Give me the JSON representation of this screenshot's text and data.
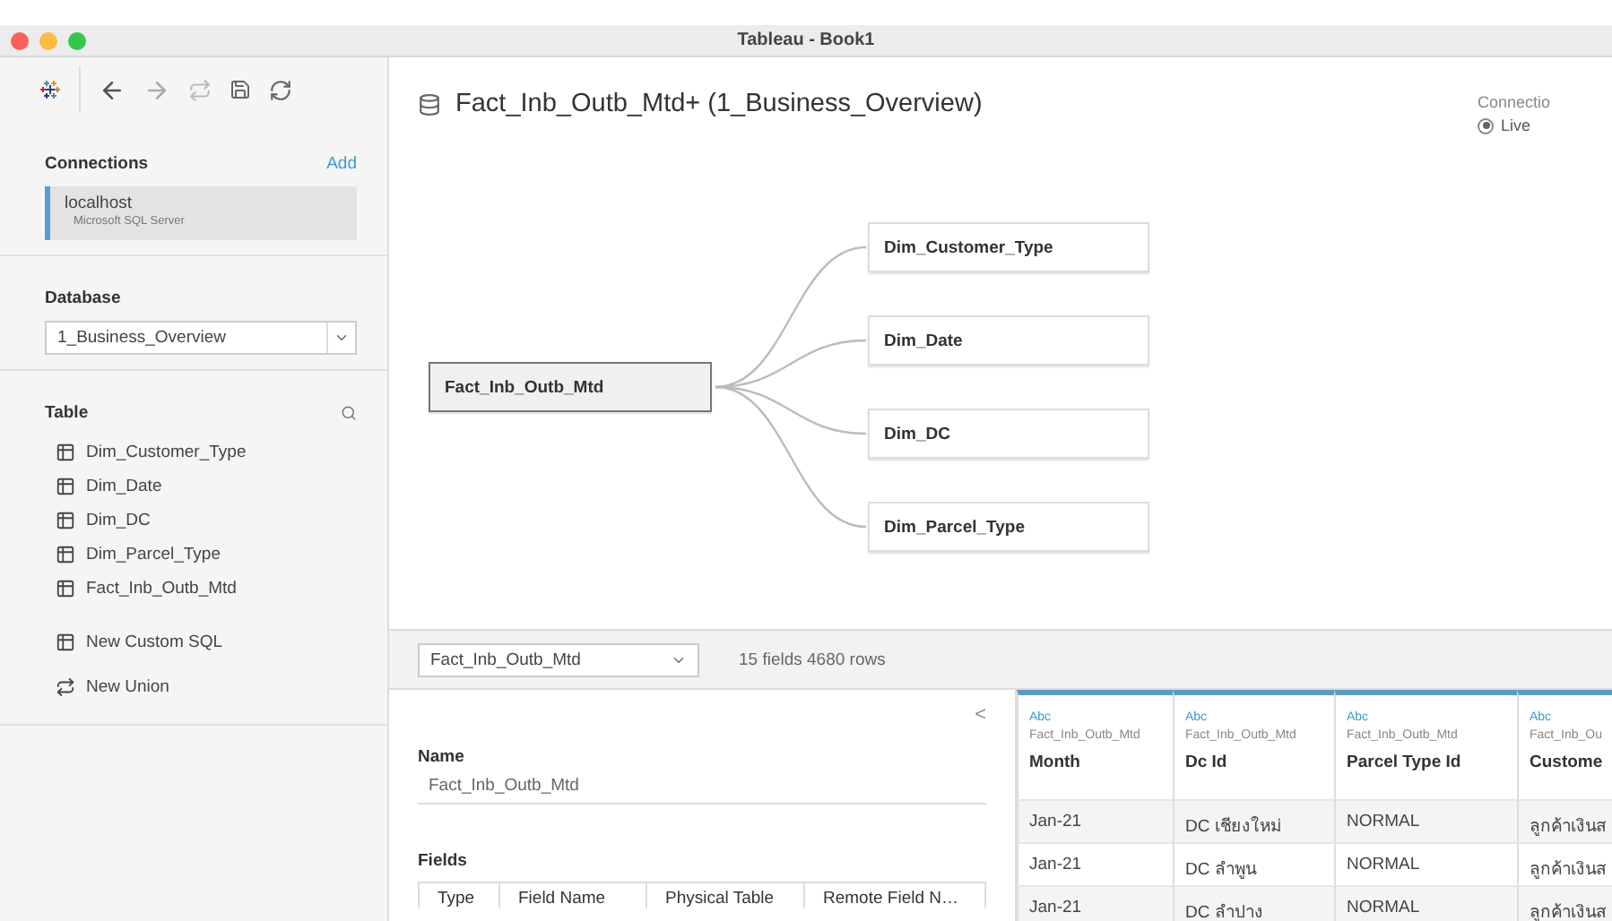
{
  "window": {
    "title": "Tableau - Book1"
  },
  "sidebar": {
    "connections_heading": "Connections",
    "add_link": "Add",
    "connections": [
      {
        "name": "localhost",
        "type": "Microsoft SQL Server",
        "selected": true
      }
    ],
    "database_heading": "Database",
    "database": "1_Business_Overview",
    "table_heading": "Table",
    "tables": [
      "Dim_Customer_Type",
      "Dim_Date",
      "Dim_DC",
      "Dim_Parcel_Type",
      "Fact_Inb_Outb_Mtd"
    ],
    "actions": [
      {
        "kind": "custom_sql",
        "label": "New Custom SQL"
      },
      {
        "kind": "union",
        "label": "New Union"
      }
    ]
  },
  "canvas": {
    "title": "Fact_Inb_Outb_Mtd+ (1_Business_Overview)",
    "connection_label": "Connectio",
    "connection_options": [
      {
        "label": "Live",
        "selected": true
      }
    ],
    "root": "Fact_Inb_Outb_Mtd",
    "joins": [
      "Dim_Customer_Type",
      "Dim_Date",
      "Dim_DC",
      "Dim_Parcel_Type"
    ]
  },
  "table_bar": {
    "table": "Fact_Inb_Outb_Mtd",
    "summary": "15 fields 4680 rows"
  },
  "metadata": {
    "collapse": "<",
    "name_label": "Name",
    "name_value": "Fact_Inb_Outb_Mtd",
    "fields_label": "Fields",
    "columns": [
      "Type",
      "Field Name",
      "Physical Table",
      "Remote Field N…"
    ]
  },
  "grid": {
    "columns": [
      {
        "type": "Abc",
        "source": "Fact_Inb_Outb_Mtd",
        "name": "Month"
      },
      {
        "type": "Abc",
        "source": "Fact_Inb_Outb_Mtd",
        "name": "Dc Id"
      },
      {
        "type": "Abc",
        "source": "Fact_Inb_Outb_Mtd",
        "name": "Parcel Type Id"
      },
      {
        "type": "Abc",
        "source": "Fact_Inb_Ou",
        "name": "Custome"
      }
    ],
    "rows": [
      [
        "Jan-21",
        "DC เชียงใหม่",
        "NORMAL",
        "ลูกค้าเงินส"
      ],
      [
        "Jan-21",
        "DC ลำพูน",
        "NORMAL",
        "ลูกค้าเงินส"
      ],
      [
        "Jan-21",
        "DC ลำปาง",
        "NORMAL",
        "ลูกค้าเงินส"
      ]
    ]
  }
}
